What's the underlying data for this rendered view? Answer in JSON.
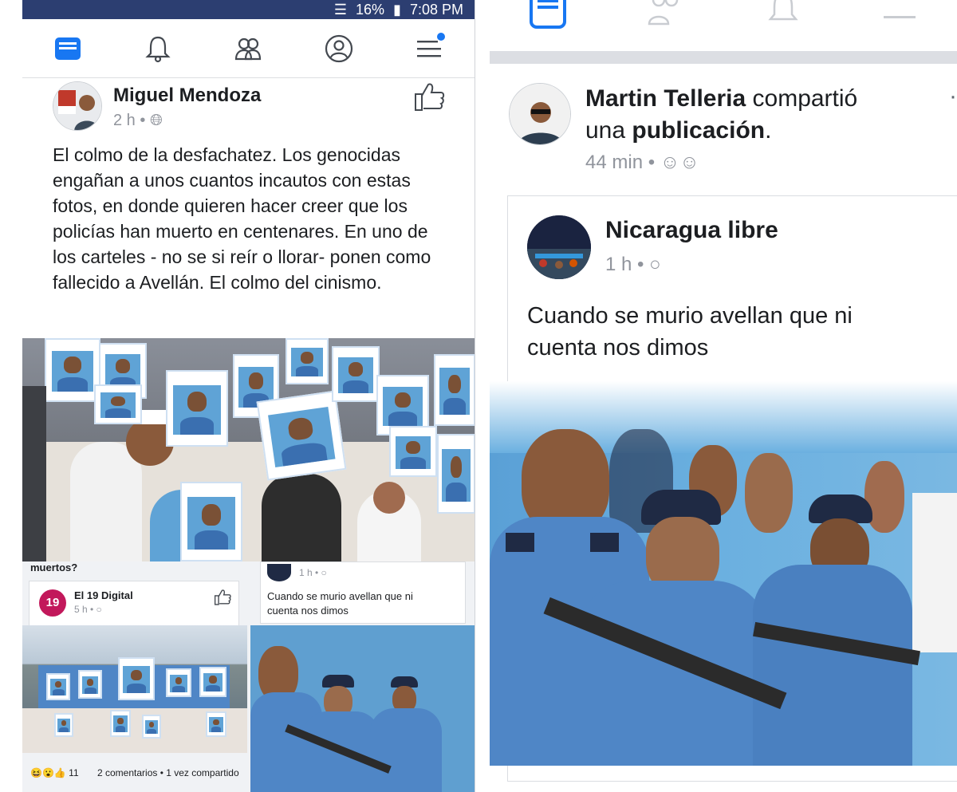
{
  "left_post": {
    "status_bar": {
      "battery": "16%",
      "time": "7:08 PM"
    },
    "author": "Miguel Mendoza",
    "time": "2 h",
    "text": "El colmo de la desfachatez. Los genocidas engañan a unos cuantos incautos con estas fotos, en donde quieren hacer creer que los policías han muerto en centenares. En uno de los carteles - no se si reír o llorar- ponen como fallecido a Avellán. El colmo del cinismo.",
    "embedded": {
      "cut_text": "muertos?",
      "card_a": {
        "author": "El 19 Digital",
        "time": "5 h",
        "avatar_text": "19"
      },
      "card_b": {
        "time": "1 h",
        "text": "Cuando se murio avellan que ni cuenta nos dimos"
      },
      "footer": {
        "reaction_count": "11",
        "stats": "2 comentarios • 1 vez compartido"
      }
    }
  },
  "right_post": {
    "sharer": "Martin Telleria",
    "share_verb": "compartió",
    "share_line2_pre": "una",
    "share_line2_bold": "publicación",
    "share_line2_post": ".",
    "time": "44 min",
    "inner": {
      "author": "Nicaragua libre",
      "time": "1 h",
      "text": "Cuando se murio avellan que ni cuenta nos dimos"
    }
  },
  "icons": {
    "left_nav": [
      "news-feed-icon",
      "bell-icon",
      "friends-icon",
      "profile-icon",
      "menu-icon"
    ],
    "right_nav": [
      "news-feed-icon",
      "friends-icon",
      "bell-icon",
      "menu-icon"
    ]
  },
  "colors": {
    "brand": "#1877f2",
    "status_bar": "#2c3e71",
    "police_blue": "#4f86c6"
  }
}
